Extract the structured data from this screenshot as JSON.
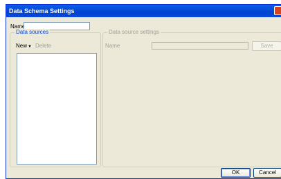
{
  "window": {
    "title": "Data Schema Settings"
  },
  "name_field": {
    "label": "Name",
    "value": ""
  },
  "data_sources": {
    "group_title": "Data sources",
    "new_label": "New",
    "new_arrow": "▼",
    "delete_label": "Delete",
    "items": []
  },
  "data_source_settings": {
    "group_title": "Data source settings",
    "name_label": "Name",
    "name_value": "",
    "save_label": "Save"
  },
  "footer": {
    "ok_label": "OK",
    "cancel_label": "Cancel"
  }
}
